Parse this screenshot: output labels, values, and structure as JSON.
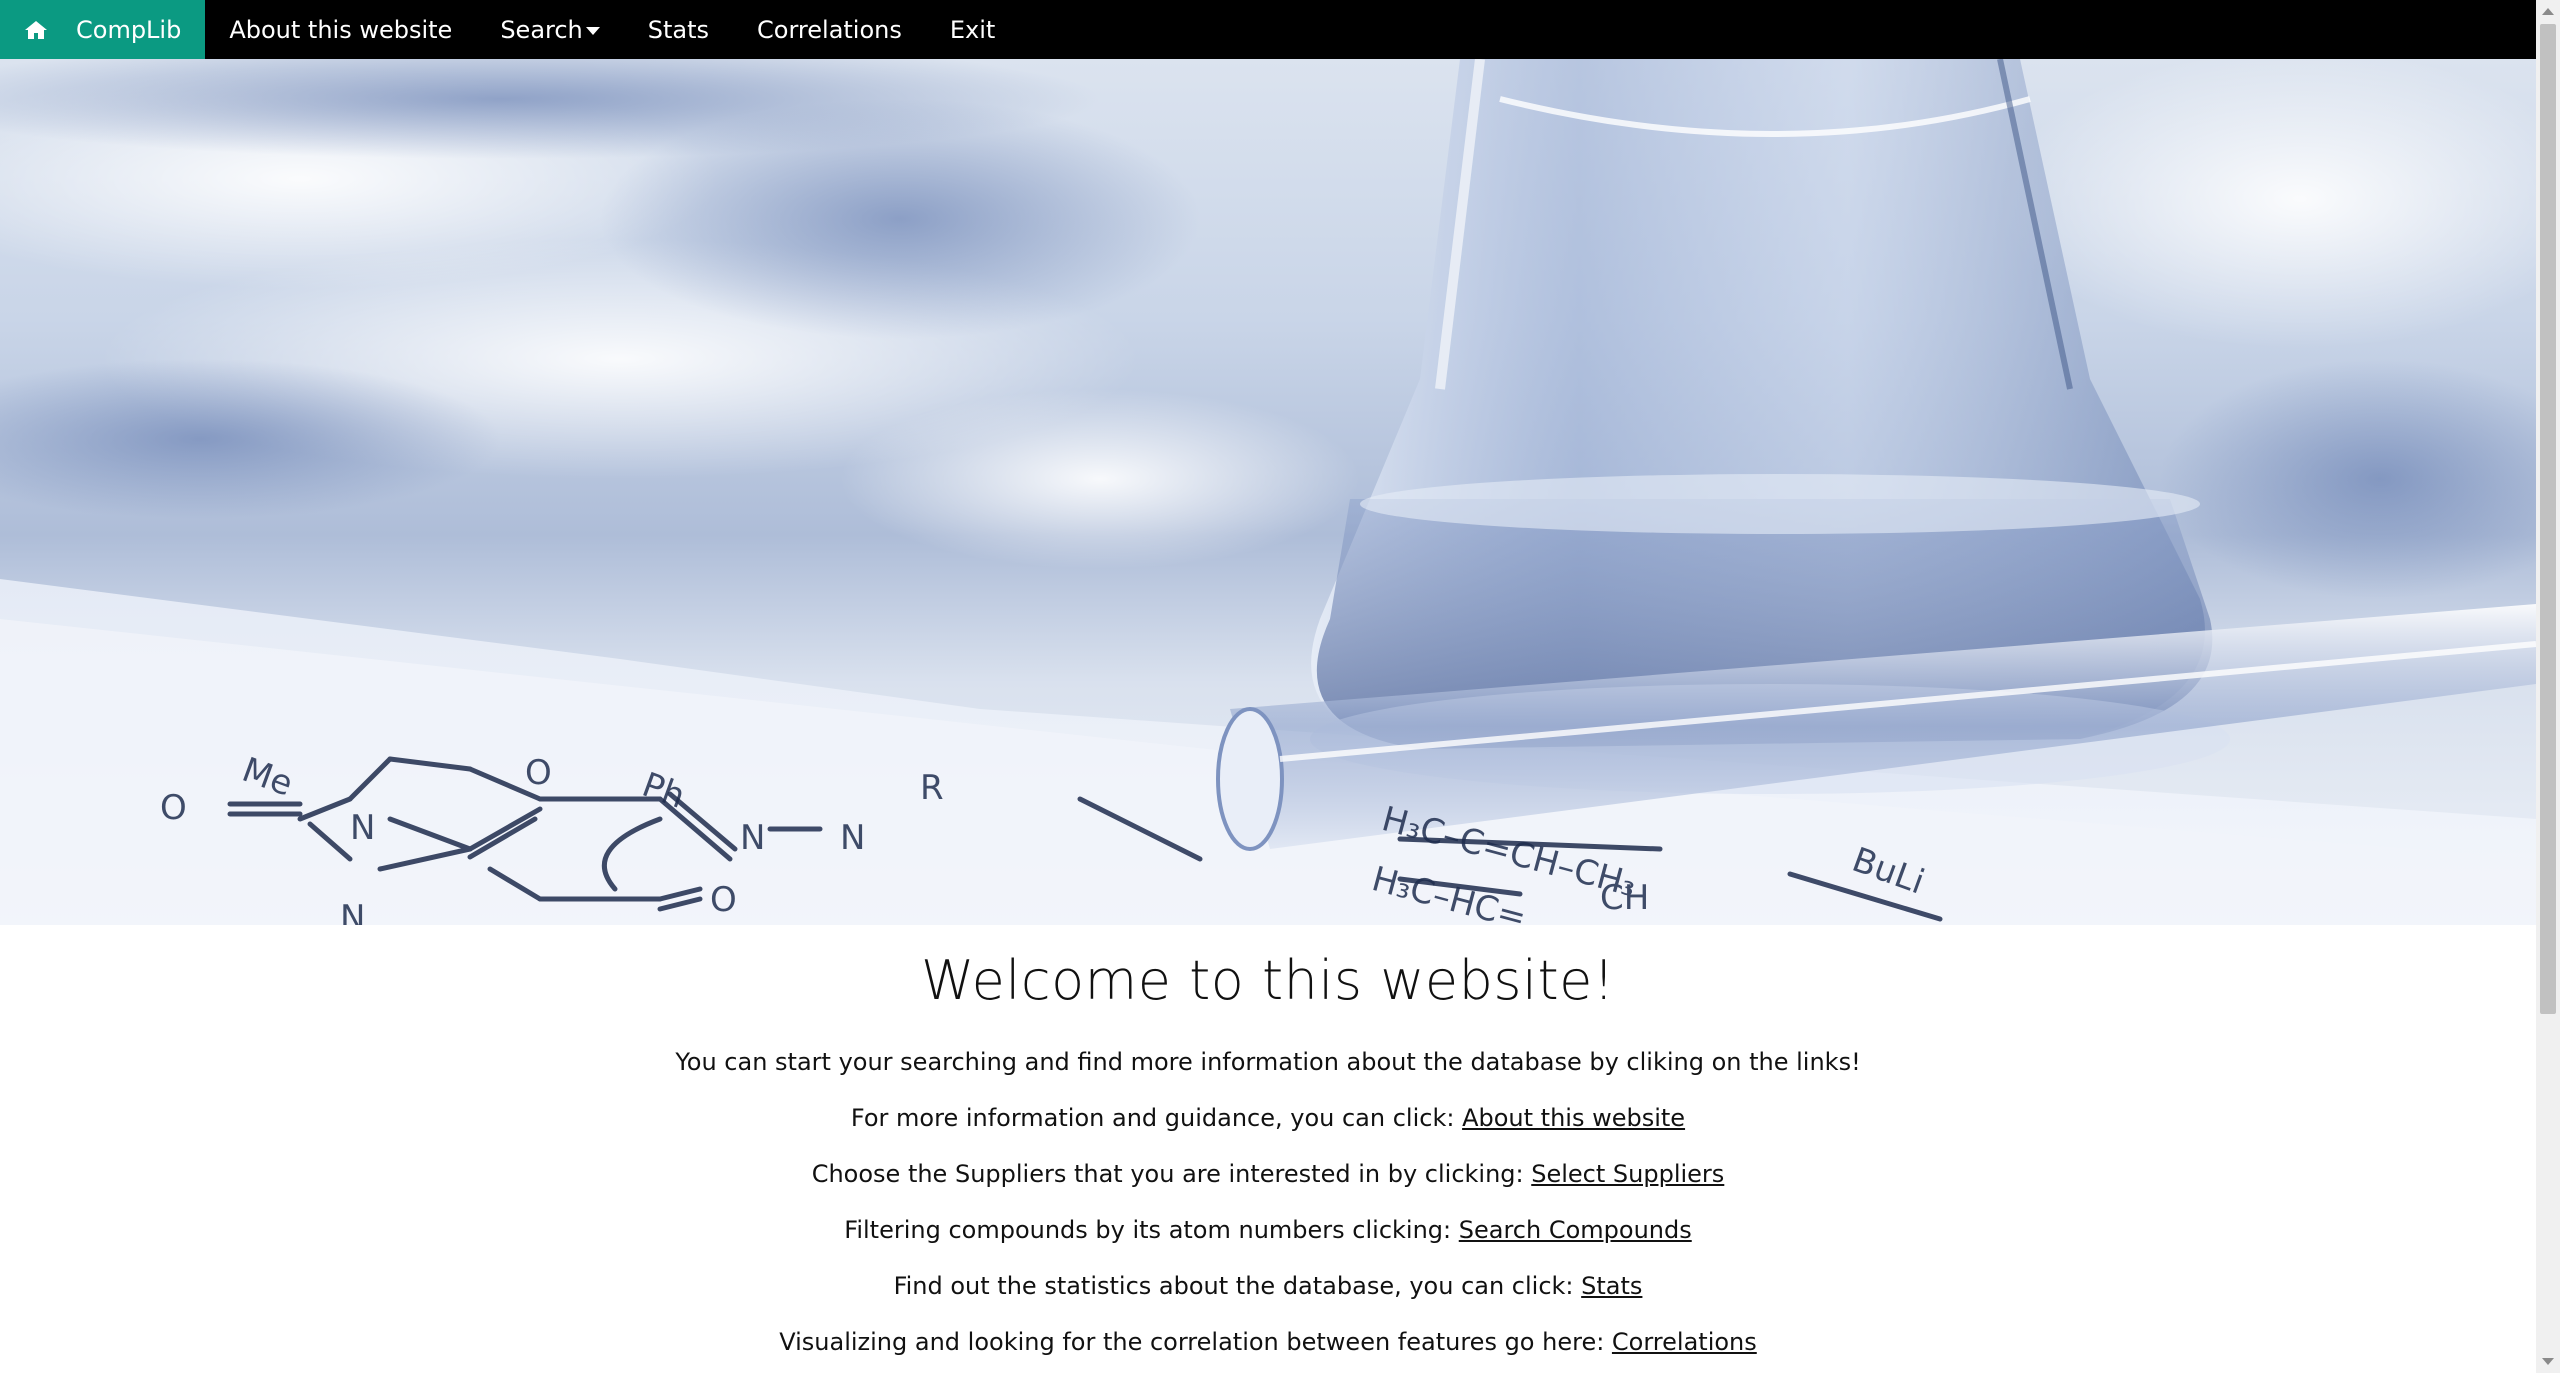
{
  "navbar": {
    "brand_icon": "home-icon",
    "brand_label": "CompLib",
    "items": [
      {
        "label": "About this website"
      },
      {
        "label": "Search",
        "icon": "caret-down-icon"
      },
      {
        "label": "Stats"
      },
      {
        "label": "Correlations"
      },
      {
        "label": "Exit"
      }
    ],
    "colors": {
      "background": "#000000",
      "brand_background": "#0b9a82",
      "text": "#ffffff"
    }
  },
  "main": {
    "title": "Welcome to this website!",
    "intro": "You can start your searching and find more information about the database by cliking on the links!",
    "lines": [
      {
        "text": "For more information and guidance, you can click: ",
        "link": "About this website"
      },
      {
        "text": "Choose the Suppliers that you are interested in by clicking: ",
        "link": "Select Suppliers"
      },
      {
        "text": "Filtering compounds by its atom numbers clicking: ",
        "link": "Search Compounds"
      },
      {
        "text": "Find out the statistics about the database, you can click: ",
        "link": "Stats"
      },
      {
        "text": "Visualizing and looking for the correlation between features go here: ",
        "link": "Correlations"
      }
    ]
  }
}
